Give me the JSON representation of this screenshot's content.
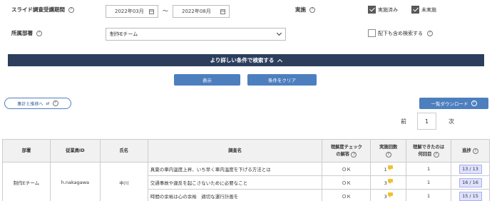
{
  "filters": {
    "slide_period_label": "スライド調査受講期間",
    "date_from": "2022年03月",
    "date_sep": "～",
    "date_to": "2022年08月",
    "implement_label": "実施",
    "implement_done": "実施済み",
    "implement_not_done": "未実施",
    "dept_label": "所属部署",
    "dept_value": "制作Eチーム",
    "include_sub_label": "配下も含め検索する",
    "include_sub_checked": false,
    "implement_done_checked": true,
    "implement_not_done_checked": true
  },
  "advanced_bar_label": "より詳しい条件で検索する",
  "buttons": {
    "display": "表示",
    "clear": "条件をクリア",
    "history": "集計と推移へ",
    "history_icon": "⇄",
    "download": "一覧ダウンロード"
  },
  "pagination": {
    "prev": "前",
    "current": "1",
    "next": "次"
  },
  "table": {
    "headers": {
      "dept": "部署",
      "emp_id": "従業員ID",
      "name": "氏名",
      "course": "調査名",
      "check": [
        "理解度チェック",
        "の解答"
      ],
      "count": "実施回数",
      "understood": [
        "理解できたのは",
        "何回目"
      ],
      "progress": "進捗"
    },
    "group": {
      "dept": "制作Eチーム",
      "emp_id": "h.nakagawa",
      "name": "中川"
    },
    "rows": [
      {
        "course": "真夏の車内温度上昇、いち早く車内温度を下げる方法とは",
        "check": "ＯＫ",
        "count": "1",
        "understood": "1",
        "progress": "13 / 13"
      },
      {
        "course": "交通事故や違反を起こさないために必要なこと",
        "check": "ＯＫ",
        "count": "3",
        "understood": "1",
        "progress": "16 / 16"
      },
      {
        "course": "時間の余裕は心の余裕　適切な運行計画を",
        "check": "ＯＫ",
        "count": "3",
        "understood": "1",
        "progress": "15 / 15"
      }
    ]
  },
  "colors": {
    "bar": "#2c3e5c",
    "button": "#4d7fbf",
    "progress_bg": "#dfe2ff"
  },
  "icons": {
    "help": "help-circle-icon",
    "calendar": "calendar-icon",
    "chevron": "chevron-down-icon",
    "caret": "caret-up-icon",
    "comment": "comment-bubble-icon"
  }
}
